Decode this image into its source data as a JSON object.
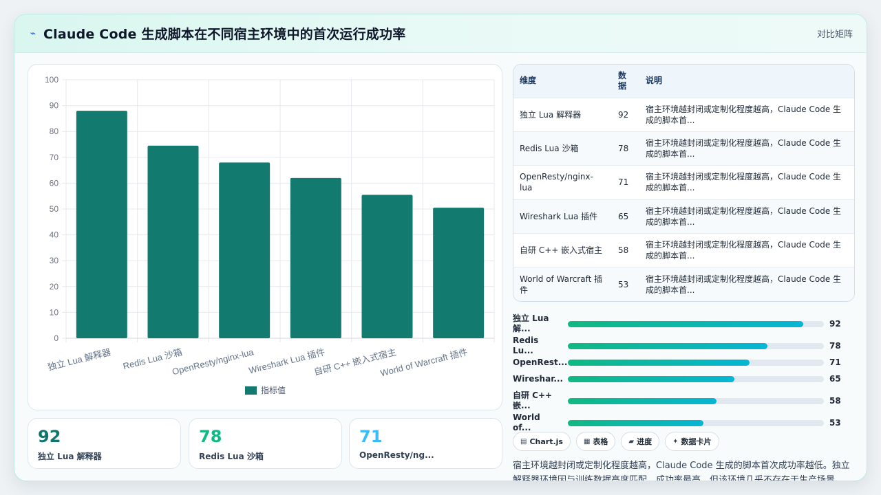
{
  "header": {
    "title": "Claude Code 生成脚本在不同宿主环境中的首次运行成功率",
    "bolt_icon": "⌁",
    "link_label": "对比矩阵"
  },
  "colors": {
    "bar": "#127a6e",
    "accent": "#10b981",
    "accent2": "#06b6d4"
  },
  "chart_data": {
    "type": "bar",
    "categories": [
      "独立 Lua 解释器",
      "Redis Lua 沙箱",
      "OpenResty/nginx-lua",
      "Wireshark Lua 插件",
      "自研 C++ 嵌入式宿主",
      "World of Warcraft 插件"
    ],
    "series": [
      {
        "name": "指标值",
        "values": [
          88,
          74.5,
          68,
          62,
          55.5,
          50.5
        ]
      }
    ],
    "ylim": [
      0,
      100
    ],
    "yticks": [
      0,
      10,
      20,
      30,
      40,
      50,
      60,
      70,
      80,
      90,
      100
    ],
    "legend": "bottom",
    "grid": true
  },
  "kpis": [
    {
      "value": "92",
      "label": "独立 Lua 解释器",
      "color": "#0f766e"
    },
    {
      "value": "78",
      "label": "Redis Lua 沙箱",
      "color": "#10b981"
    },
    {
      "value": "71",
      "label": "OpenResty/ng...",
      "color": "#38bdf8"
    }
  ],
  "table": {
    "headers": [
      "维度",
      "数据",
      "说明"
    ],
    "rows": [
      {
        "dim": "独立 Lua 解释器",
        "val": "92",
        "desc": "宿主环境越封闭或定制化程度越高，Claude Code 生成的脚本首..."
      },
      {
        "dim": "Redis Lua 沙箱",
        "val": "78",
        "desc": "宿主环境越封闭或定制化程度越高，Claude Code 生成的脚本首..."
      },
      {
        "dim": "OpenResty/nginx-lua",
        "val": "71",
        "desc": "宿主环境越封闭或定制化程度越高，Claude Code 生成的脚本首..."
      },
      {
        "dim": "Wireshark Lua 插件",
        "val": "65",
        "desc": "宿主环境越封闭或定制化程度越高，Claude Code 生成的脚本首..."
      },
      {
        "dim": "自研 C++ 嵌入式宿主",
        "val": "58",
        "desc": "宿主环境越封闭或定制化程度越高，Claude Code 生成的脚本首..."
      },
      {
        "dim": "World of Warcraft 插件",
        "val": "53",
        "desc": "宿主环境越封闭或定制化程度越高，Claude Code 生成的脚本首..."
      }
    ]
  },
  "progress": [
    {
      "label": "独立 Lua 解...",
      "value": 92
    },
    {
      "label": "Redis Lu...",
      "value": 78
    },
    {
      "label": "OpenRest...",
      "value": 71
    },
    {
      "label": "Wireshar...",
      "value": 65
    },
    {
      "label": "自研 C++ 嵌...",
      "value": 58
    },
    {
      "label": "World of...",
      "value": 53
    }
  ],
  "chips": [
    {
      "icon": "▤",
      "label": "Chart.js"
    },
    {
      "icon": "▦",
      "label": "表格"
    },
    {
      "icon": "▰",
      "label": "进度"
    },
    {
      "icon": "✦",
      "label": "数据卡片"
    }
  ],
  "summary": "宿主环境越封闭或定制化程度越高，Claude Code 生成的脚本首次成功率越低。独立解释器环境因与训练数据高度匹配，成功率最高，但该环境几乎不存在于生产场景。"
}
